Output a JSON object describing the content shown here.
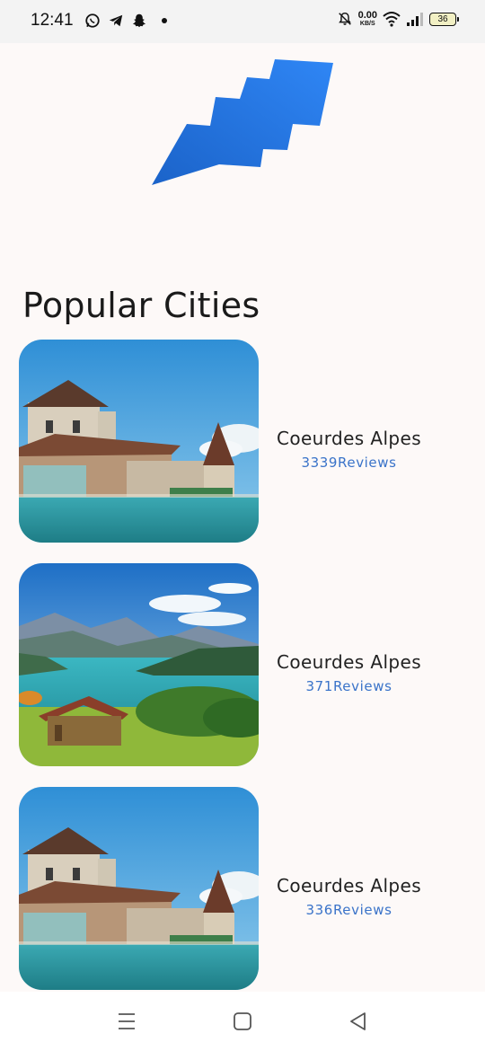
{
  "status_bar": {
    "time": "12:41",
    "left_icons": [
      "whatsapp-icon",
      "telegram-icon",
      "snapchat-icon",
      "notification-dot-icon"
    ],
    "net_speed_value": "0.00",
    "net_speed_unit": "KB/S",
    "battery_level": "36"
  },
  "logo": {
    "icon": "brand-logo",
    "colors": [
      "#1b63c9",
      "#2f86f5"
    ]
  },
  "section": {
    "title": "Popular Cities"
  },
  "cities": [
    {
      "name": "Coeurdes Alpes",
      "reviews": "3339Reviews",
      "image": "lake-castle-image"
    },
    {
      "name": "Coeurdes Alpes",
      "reviews": "371Reviews",
      "image": "mountain-lake-image"
    },
    {
      "name": "Coeurdes Alpes",
      "reviews": "336Reviews",
      "image": "lake-castle-image"
    }
  ],
  "nav_bar": {
    "buttons": [
      "menu-icon",
      "home-square-icon",
      "back-triangle-icon"
    ]
  },
  "colors": {
    "accent": "#3a73c9",
    "background": "#fdf9f8"
  }
}
